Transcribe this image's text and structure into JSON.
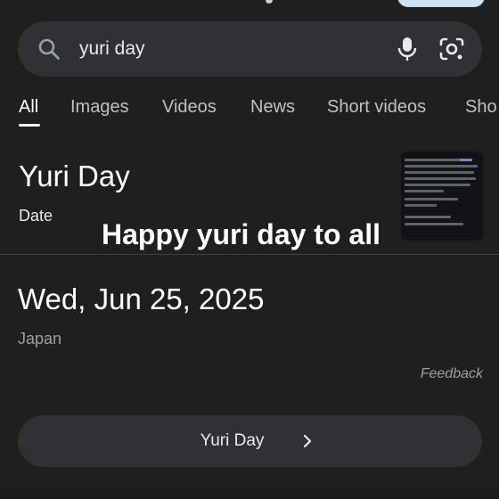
{
  "search": {
    "query": "yuri day",
    "icon": "search-icon",
    "mic_icon": "mic-icon",
    "lens_icon": "google-lens-icon"
  },
  "tabs": [
    {
      "label": "All",
      "active": true
    },
    {
      "label": "Images"
    },
    {
      "label": "Videos"
    },
    {
      "label": "News"
    },
    {
      "label": "Short videos"
    },
    {
      "label": "Sho"
    }
  ],
  "result": {
    "title": "Yuri Day",
    "subtitle": "Date",
    "date": "Wed, Jun 25, 2025",
    "location": "Japan",
    "feedback": "Feedback",
    "more_label": "Yuri Day"
  },
  "overlay": {
    "caption": "Happy yuri day to all"
  },
  "colors": {
    "background": "#1f1f1f",
    "surface": "#303134",
    "text": "#e8eaed",
    "muted": "#9aa0a6"
  }
}
